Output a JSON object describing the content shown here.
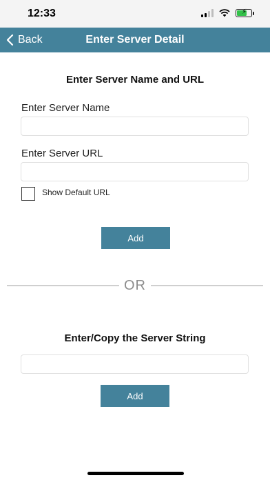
{
  "status_bar": {
    "time": "12:33",
    "icons": [
      "signal-icon",
      "wifi-icon",
      "battery-charging-icon"
    ]
  },
  "nav": {
    "back_label": "Back",
    "title": "Enter Server Detail",
    "color": "#44829b"
  },
  "server_form": {
    "title": "Enter Server Name and URL",
    "name_label": "Enter Server Name",
    "name_value": "",
    "url_label": "Enter Server URL",
    "url_value": "",
    "show_default_label": "Show Default URL",
    "show_default_checked": false,
    "add_label": "Add"
  },
  "separator": {
    "text": "OR"
  },
  "server_string": {
    "title": "Enter/Copy the Server String",
    "value": "",
    "add_label": "Add"
  }
}
